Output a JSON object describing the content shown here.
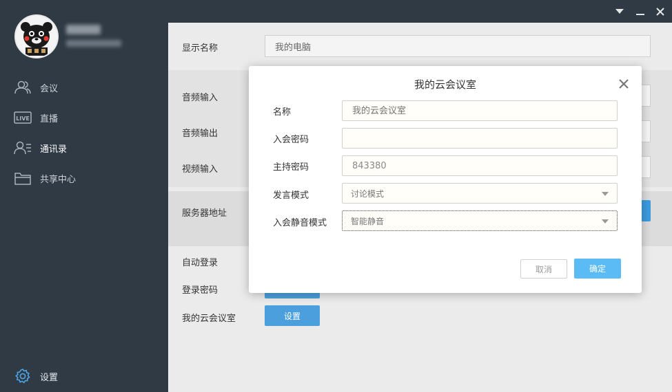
{
  "sidebar": {
    "items": [
      {
        "label": "会议",
        "icon": "people-icon"
      },
      {
        "label": "直播",
        "icon": "live-icon"
      },
      {
        "label": "通讯录",
        "icon": "contacts-icon"
      },
      {
        "label": "共享中心",
        "icon": "folder-icon"
      }
    ],
    "settings_label": "设置"
  },
  "titlebar": {
    "buttons": [
      "dropdown-icon",
      "minimize-icon",
      "close-icon"
    ]
  },
  "settings": {
    "display_name_label": "显示名称",
    "display_name_value": "我的电脑",
    "audio_input_label": "音频输入",
    "audio_output_label": "音频输出",
    "video_input_label": "视频输入",
    "server_address_label": "服务器地址",
    "auto_login_label": "自动登录",
    "login_password_label": "登录密码",
    "my_room_label": "我的云会议室",
    "set_button_label": "设置"
  },
  "modal": {
    "title": "我的云会议室",
    "fields": {
      "name_label": "名称",
      "name_placeholder": "我的云会议室",
      "join_password_label": "入会密码",
      "join_password_value": "",
      "host_password_label": "主持密码",
      "host_password_value": "843380",
      "speak_mode_label": "发言模式",
      "speak_mode_value": "讨论模式",
      "mute_mode_label": "入会静音模式",
      "mute_mode_value": "智能静音"
    },
    "cancel_label": "取消",
    "ok_label": "确定"
  },
  "colors": {
    "sidebar_bg": "#2f3a44",
    "accent_blue": "#4a9fdc",
    "ok_button": "#5bbcf5"
  }
}
